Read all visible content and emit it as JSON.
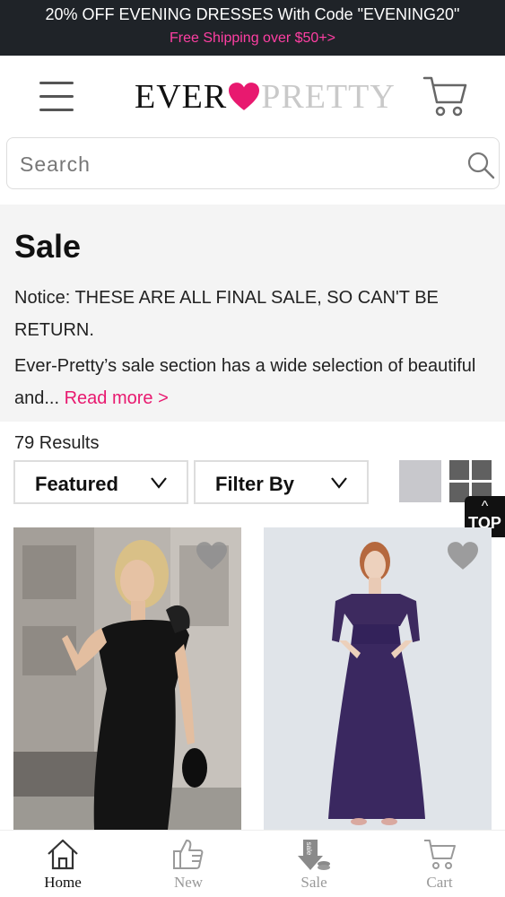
{
  "promo": {
    "line1": "20% OFF EVENING DRESSES With Code \"EVENING20\"",
    "line2": "Free Shipping over $50+>"
  },
  "header": {
    "logo_left": "EVER",
    "logo_right": "PRETTY",
    "menu_icon": "hamburger-menu-icon",
    "cart_icon": "shopping-cart-icon"
  },
  "search": {
    "placeholder": "Search",
    "value": "",
    "icon": "search-icon"
  },
  "intro": {
    "title": "Sale",
    "notice": "Notice: THESE ARE ALL FINAL SALE, SO CAN'T BE RETURN.",
    "description": "Ever-Pretty’s sale section has a wide selection of beautiful and...",
    "read_more": "Read more >"
  },
  "listing": {
    "results": "79 Results",
    "sort_label": "Featured",
    "filter_label": "Filter By",
    "top_button": "TOP",
    "top_caret": "^"
  },
  "products": [
    {
      "favorite_icon": "heart-icon",
      "image": "black one-shoulder sheath dress photo"
    },
    {
      "favorite_icon": "heart-icon",
      "image": "purple off-shoulder long chiffon dress photo"
    }
  ],
  "bottom_nav": [
    {
      "label": "Home",
      "icon": "house-icon",
      "active": true
    },
    {
      "label": "New",
      "icon": "thumbs-up-icon",
      "active": false
    },
    {
      "label": "Sale",
      "icon": "sale-tag-icon",
      "active": false
    },
    {
      "label": "Cart",
      "icon": "cart-icon",
      "active": false
    }
  ],
  "colors": {
    "accent_pink": "#e8196f",
    "promo_background": "#1f2328",
    "intro_background": "#f4f4f4"
  }
}
